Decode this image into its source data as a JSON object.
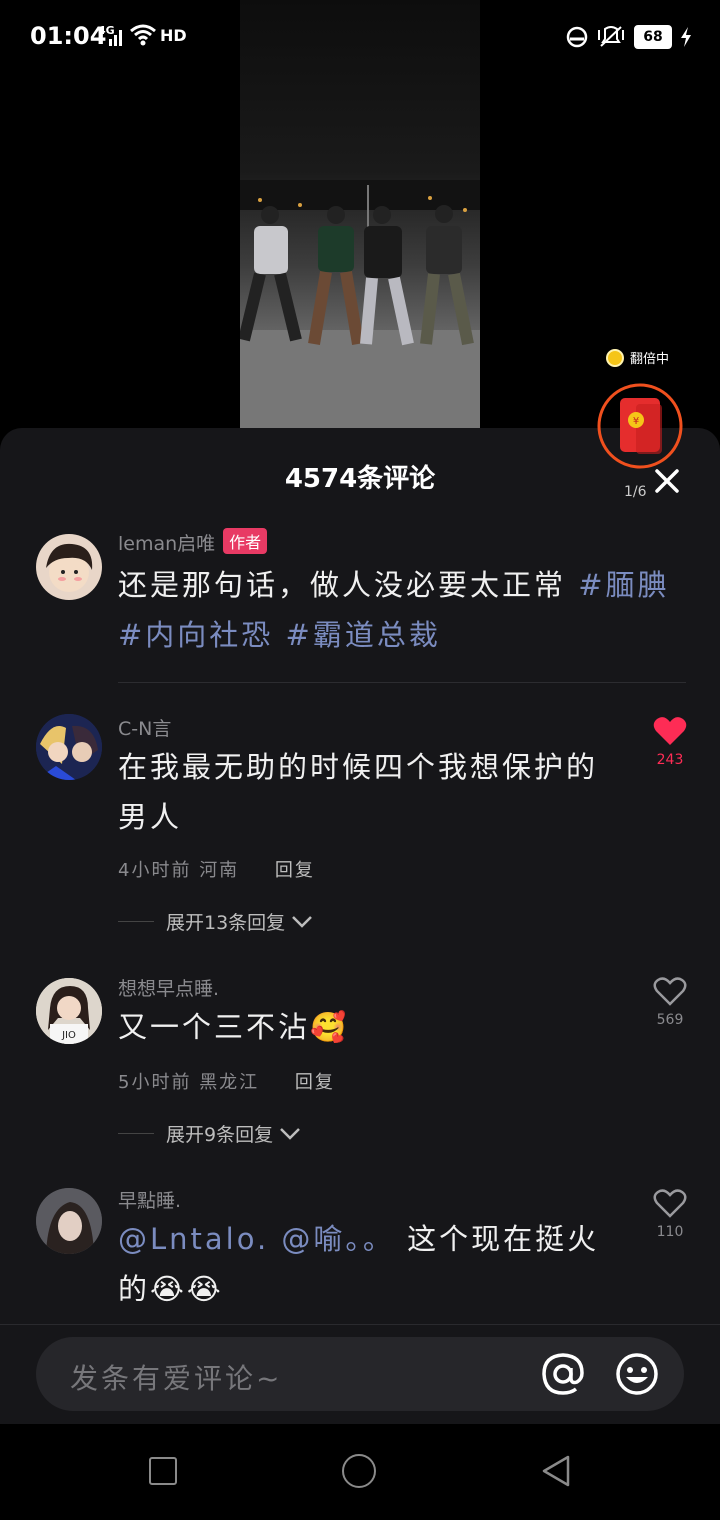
{
  "status_bar": {
    "time": "01:04",
    "network": "4G",
    "hd": "HD",
    "battery": "68"
  },
  "red_packet": {
    "label": "翻倍中",
    "count": "1/6"
  },
  "comments_panel": {
    "title": "4574条评论",
    "input_placeholder": "发条有爱评论~"
  },
  "comments": [
    {
      "user": "leman启唯",
      "badge": "作者",
      "text_prefix": "还是那句话，做人没必要太正常 ",
      "tags": [
        "#腼腆",
        "#内向社恐",
        "#霸道总裁"
      ]
    },
    {
      "user": "C-N言",
      "text": "在我最无助的时候四个我想保护的男人",
      "time": "4小时前",
      "location": "河南",
      "reply_label": "回复",
      "expand_label": "展开13条回复",
      "likes": "243",
      "liked": true
    },
    {
      "user": "想想早点睡.",
      "text": "又一个三不沾🥰",
      "time": "5小时前",
      "location": "黑龙江",
      "reply_label": "回复",
      "expand_label": "展开9条回复",
      "likes": "569",
      "liked": false
    },
    {
      "user": "早點睡.",
      "mentions": "@Lntalo. @喻。。",
      "text_suffix": " 这个现在挺火的😭😭",
      "likes": "110",
      "liked": false
    }
  ],
  "colors": {
    "sheet_bg": "#161619",
    "tag": "#7b8cc0",
    "like_red": "#fe2c55",
    "badge": "#e83a64",
    "red_packet": "#e52d2d"
  },
  "icons": [
    "signal-icon",
    "wifi-icon",
    "alarm-icon",
    "mute-icon",
    "close-icon",
    "heart-icon",
    "at-icon",
    "emoji-icon",
    "chevron-down-icon"
  ]
}
